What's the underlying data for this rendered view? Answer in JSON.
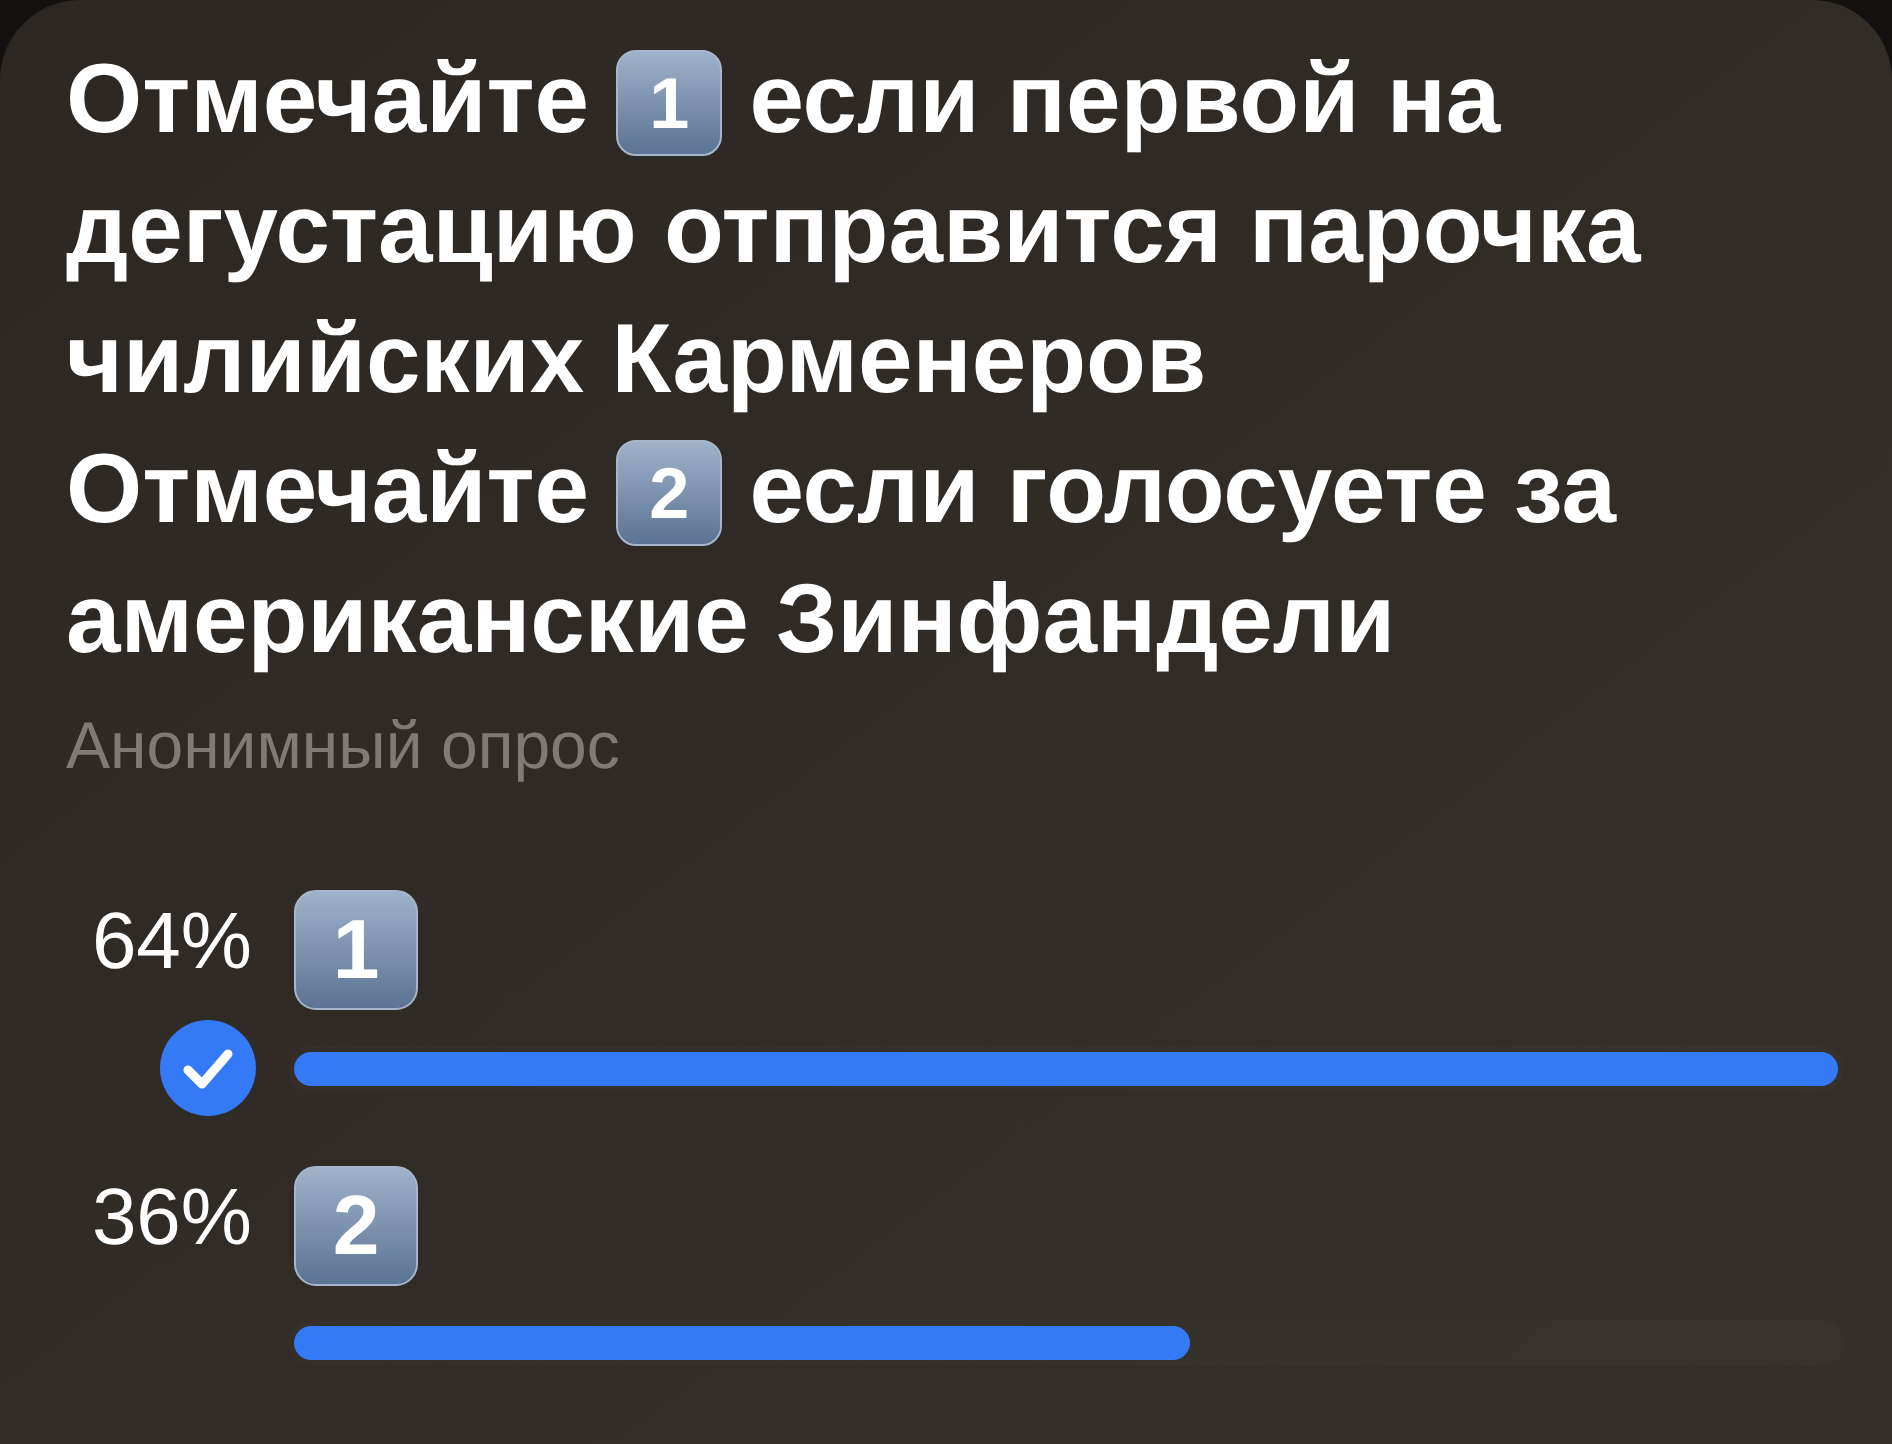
{
  "question": {
    "paragraphs": [
      [
        {
          "kind": "text",
          "text": "Отмечайте "
        },
        {
          "kind": "keycap",
          "text": "1"
        },
        {
          "kind": "text",
          "text": " если первой на дегустацию отправится парочка чилийских Карменеров"
        }
      ],
      [
        {
          "kind": "text",
          "text": "Отмечайте "
        },
        {
          "kind": "keycap",
          "text": "2"
        },
        {
          "kind": "text",
          "text": " если голосуете за американские Зинфандели"
        }
      ]
    ]
  },
  "poll_type": "Анонимный опрос",
  "options": [
    {
      "percent": "64%",
      "label": "1",
      "selected": true,
      "level": 1
    },
    {
      "percent": "36%",
      "label": "2",
      "selected": false,
      "level": 0.58
    }
  ]
}
